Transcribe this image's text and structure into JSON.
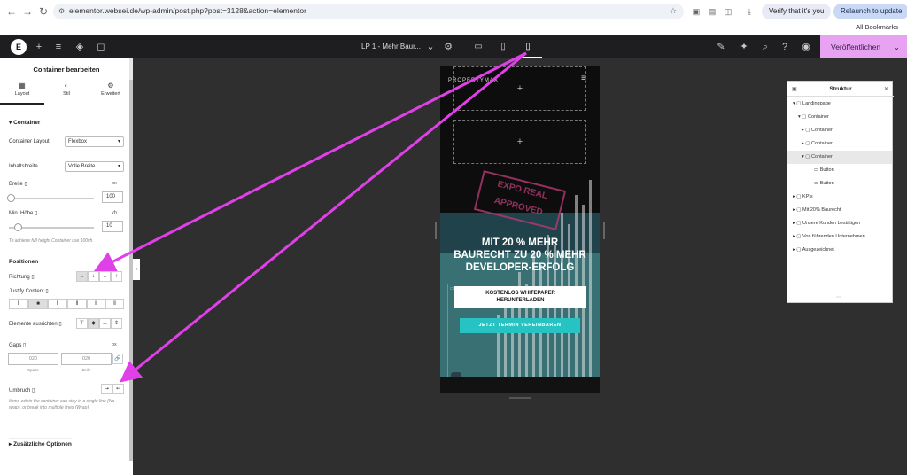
{
  "browser": {
    "url": "elementor.websei.de/wp-admin/post.php?post=3128&action=elementor",
    "verify": "Verify that it's you",
    "relaunch": "Relaunch to update",
    "bookmarks": "All Bookmarks"
  },
  "topbar": {
    "doc_name": "LP 1 - Mehr Baur...",
    "publish": "Veröffentlichen"
  },
  "panel": {
    "title": "Container bearbeiten",
    "tabs": [
      "Layout",
      "Stil",
      "Erweitert"
    ],
    "section_container": "Container",
    "container_layout_label": "Container Layout",
    "container_layout_value": "Flexbox",
    "content_width_label": "Inhaltsbreite",
    "content_width_value": "Volle Breite",
    "width_label": "Breite",
    "width_unit": "px",
    "width_value": "100",
    "min_height_label": "Min. Höhe",
    "min_height_unit": "vh",
    "min_height_value": "10",
    "height_hint": "To achieve full height Container use 100vh.",
    "section_position": "Positionen",
    "direction_label": "Richtung",
    "justify_label": "Justify Content",
    "align_label": "Elemente ausrichten",
    "gaps_label": "Gaps",
    "gaps_unit": "px",
    "gap_col": "020",
    "gap_row": "020",
    "gap_col_label": "Spalte",
    "gap_row_label": "Zeile",
    "wrap_label": "Umbruch",
    "wrap_hint": "Items within the container can stay in a single line (No wrap), or break into multiple lines (Wrap).",
    "section_extra": "Zusätzliche Optionen"
  },
  "preview": {
    "logo": "PROPERTYMAX",
    "headline": [
      "MIT 20 % MEHR",
      "BAURECHT ZU 20 % MEHR",
      "DEVELOPER-ERFOLG"
    ],
    "cta1": [
      "KOSTENLOS WHITEPAPER",
      "HERUNTERLADEN"
    ],
    "cta2": "JETZT TERMIN VEREINBAREN",
    "stamp": [
      "EXPO REAL",
      "APPROVED"
    ]
  },
  "structure": {
    "title": "Struktur",
    "items": [
      "Landingpage",
      "Container",
      "Container",
      "Container",
      "Container",
      "Button",
      "Button",
      "KPIs",
      "Mit 20% Baurecht",
      "Unsere Kunden bestätigen",
      "Von führenden Unternehmen",
      "Ausgezeichnet"
    ]
  },
  "colors": {
    "publish": "#e7a3f2",
    "teal": "#27c3c3",
    "annotation_arrow": "#e040e8"
  }
}
